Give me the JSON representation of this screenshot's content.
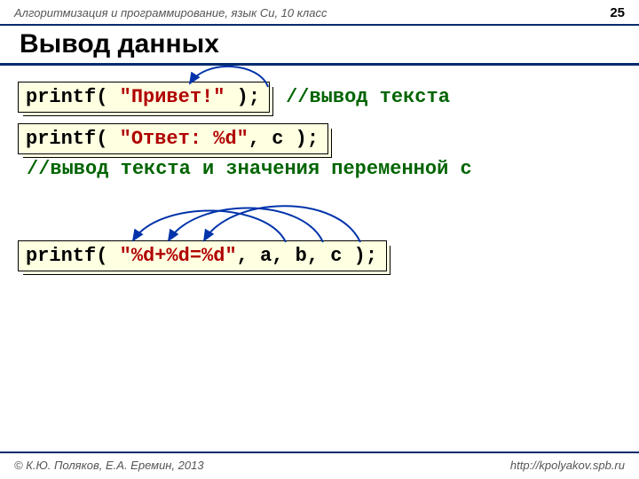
{
  "header": {
    "course": "Алгоритмизация и программирование, язык Си, 10 класс",
    "page_number": "25"
  },
  "title": "Вывод данных",
  "example1": {
    "fn": "printf",
    "open": "( ",
    "string": "\"Привет!\"",
    "close": " );",
    "comment": "//вывод текста"
  },
  "example2": {
    "fn": "printf",
    "open": "( ",
    "string": "\"Ответ: %d\"",
    "args": ", c );",
    "comment": "//вывод текста и значения переменной c"
  },
  "example3": {
    "fn": "printf",
    "open": "( ",
    "string": "\"%d+%d=%d\"",
    "args": ", a, b, c );"
  },
  "footer": {
    "copyright": "© К.Ю. Поляков, Е.А. Еремин, 2013",
    "url": "http://kpolyakov.spb.ru"
  }
}
